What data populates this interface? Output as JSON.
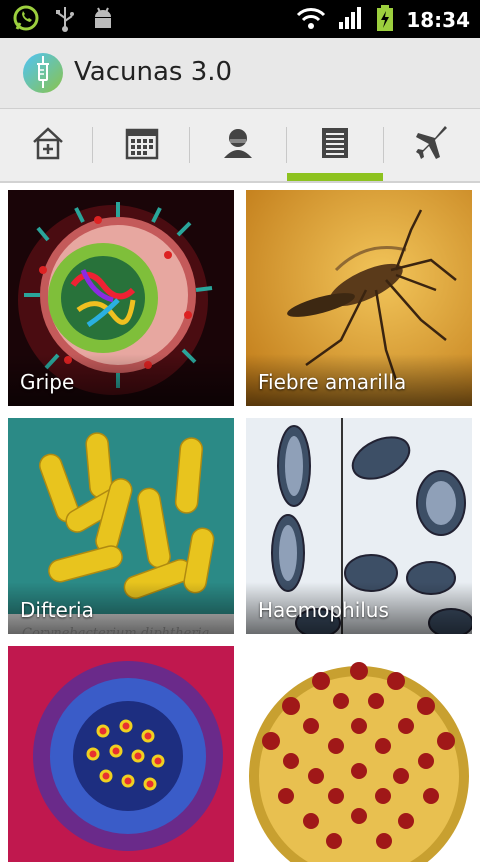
{
  "status_bar": {
    "time": "18:34",
    "icons": [
      "whatsapp-icon",
      "usb-icon",
      "android-debug-icon",
      "wifi-icon",
      "signal-icon",
      "battery-charging-icon"
    ]
  },
  "app": {
    "title": "Vacunas 3.0",
    "logo": "syringe-logo"
  },
  "tabs": [
    {
      "name": "home-add",
      "icon": "home-plus-icon",
      "selected": false
    },
    {
      "name": "calendar",
      "icon": "calendar-icon",
      "selected": false
    },
    {
      "name": "profile",
      "icon": "person-icon",
      "selected": false
    },
    {
      "name": "list",
      "icon": "list-icon",
      "selected": true
    },
    {
      "name": "travel",
      "icon": "airplane-icon",
      "selected": false
    }
  ],
  "accent_color": "#8dc21f",
  "vaccines": [
    {
      "label": "Gripe"
    },
    {
      "label": "Fiebre amarilla"
    },
    {
      "label": "Difteria",
      "image_caption": "Corynebacterium diphtheria"
    },
    {
      "label": "Haemophilus"
    },
    {
      "label": ""
    },
    {
      "label": ""
    }
  ]
}
